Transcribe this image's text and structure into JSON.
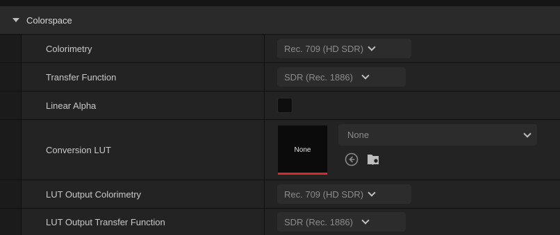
{
  "section": {
    "title": "Colorspace"
  },
  "rows": [
    {
      "label": "Colorimetry",
      "value": "Rec. 709 (HD SDR)"
    },
    {
      "label": "Transfer Function",
      "value": "SDR (Rec. 1886)"
    },
    {
      "label": "Linear Alpha",
      "checked": false
    },
    {
      "label": "Conversion LUT",
      "thumbnail": "None",
      "asset": "None"
    },
    {
      "label": "LUT Output Colorimetry",
      "value": "Rec. 709 (HD SDR)"
    },
    {
      "label": "LUT Output Transfer Function",
      "value": "SDR (Rec. 1886)"
    }
  ],
  "icons": {
    "section_toggle": "caret-down-icon",
    "dropdown": "chevron-down-icon",
    "use_selected": "arrow-left-circle-icon",
    "browse": "folder-search-icon"
  },
  "colors": {
    "thumbnail_accent": "#d92b2b"
  }
}
